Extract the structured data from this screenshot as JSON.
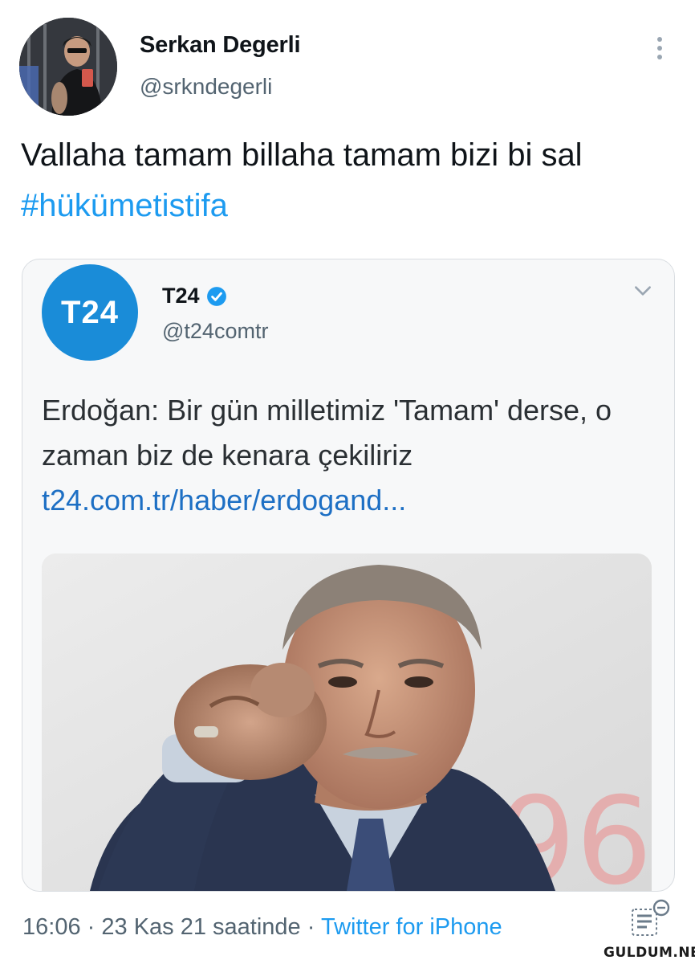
{
  "user": {
    "display_name": "Serkan Degerli",
    "handle": "@srkndegerli"
  },
  "tweet": {
    "text_before": "Vallaha tamam billaha tamam bizi bi sal ",
    "hashtag": "#hükümetistifa"
  },
  "quoted_tweet": {
    "avatar_text": "T24",
    "display_name": "T24",
    "handle": "@t24comtr",
    "text": "Erdoğan: Bir gün milletimiz 'Tamam' derse, o zaman biz de kenara çekiliriz",
    "link": "t24.com.tr/haber/erdogand..."
  },
  "footer": {
    "time": "16:06",
    "date": "23 Kas 21 saatinde",
    "separator": "·",
    "source": "Twitter for iPhone"
  },
  "watermark": "GULDUM.NET",
  "colors": {
    "accent": "#1d9bf0",
    "secondary_text": "#536471",
    "quote_avatar": "#1a8cd8"
  },
  "icons": [
    "more-vertical-icon",
    "verified-icon",
    "chevron-down-icon",
    "document-icon"
  ]
}
